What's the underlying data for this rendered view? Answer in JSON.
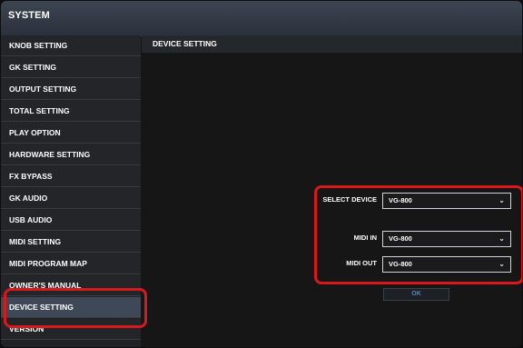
{
  "window": {
    "title": "SYSTEM"
  },
  "sidebar": {
    "items": [
      {
        "label": "KNOB SETTING"
      },
      {
        "label": "GK SETTING"
      },
      {
        "label": "OUTPUT SETTING"
      },
      {
        "label": "TOTAL SETTING"
      },
      {
        "label": "PLAY OPTION"
      },
      {
        "label": "HARDWARE SETTING"
      },
      {
        "label": "FX BYPASS"
      },
      {
        "label": "GK AUDIO"
      },
      {
        "label": "USB AUDIO"
      },
      {
        "label": "MIDI SETTING"
      },
      {
        "label": "MIDI PROGRAM MAP"
      },
      {
        "label": "OWNER'S MANUAL"
      },
      {
        "label": "DEVICE SETTING"
      },
      {
        "label": "VERSION"
      }
    ]
  },
  "content": {
    "title": "DEVICE SETTING",
    "fields": {
      "select_device": {
        "label": "SELECT DEVICE",
        "value": "VG-800"
      },
      "midi_in": {
        "label": "MIDI IN",
        "value": "VG-800"
      },
      "midi_out": {
        "label": "MIDI OUT",
        "value": "VG-800"
      }
    },
    "ok_label": "OK"
  },
  "colors": {
    "highlight": "#d7191c",
    "active_item": "#3e4856",
    "ok_text": "#4f86c6"
  },
  "icons": {
    "dropdown": "chevron-down-icon"
  }
}
